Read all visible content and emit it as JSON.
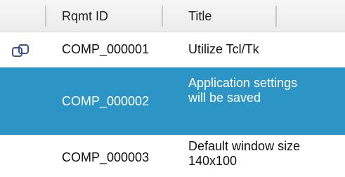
{
  "table": {
    "columns": {
      "id_header": "Rqmt ID",
      "title_header": "Title"
    },
    "rows": [
      {
        "id": "COMP_000001",
        "title": "Utilize Tcl/Tk",
        "icon": "link-icon",
        "selected": false
      },
      {
        "id": "COMP_000002",
        "title": "Application settings will be saved",
        "icon": null,
        "selected": true
      },
      {
        "id": "COMP_000003",
        "title": "Default window size 140x100",
        "icon": null,
        "selected": false
      }
    ]
  },
  "colors": {
    "selection": "#2c95c6",
    "header_bg": "#ececec",
    "icon": "#3b4f9a"
  }
}
